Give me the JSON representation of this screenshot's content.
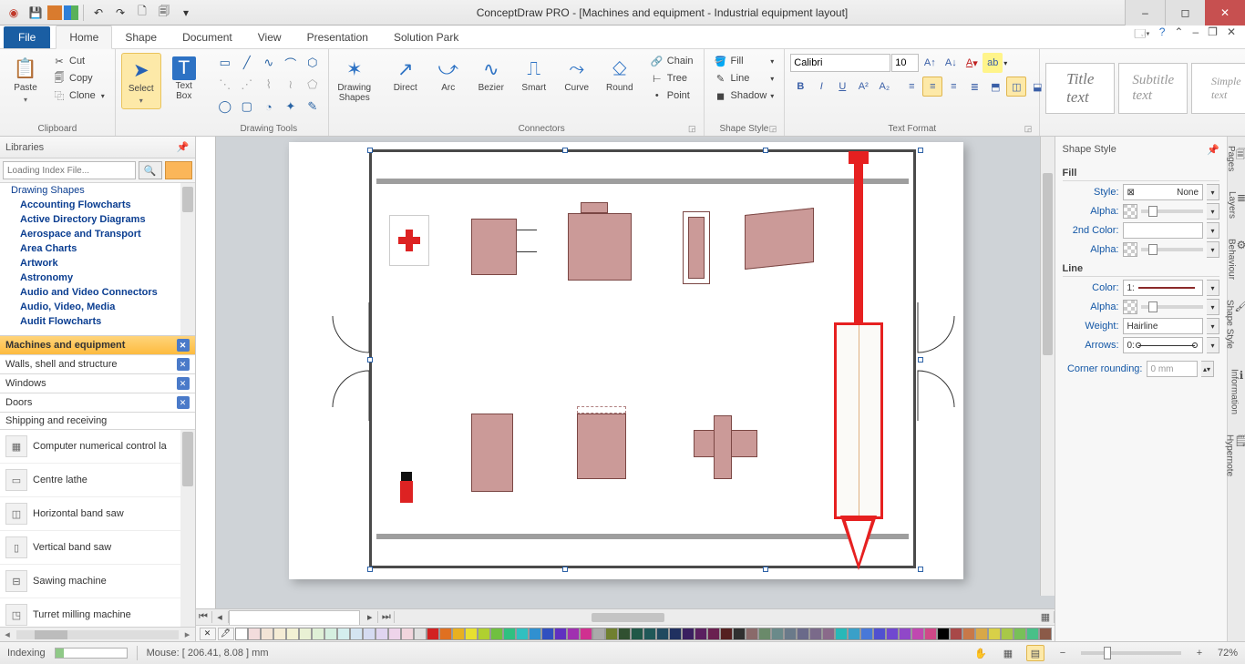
{
  "app_title": "ConceptDraw PRO - [Machines and equipment - Industrial equipment layout]",
  "tabs": {
    "file": "File",
    "home": "Home",
    "shape": "Shape",
    "document": "Document",
    "view": "View",
    "presentation": "Presentation",
    "solution": "Solution Park"
  },
  "ribbon": {
    "clipboard": {
      "label": "Clipboard",
      "paste": "Paste",
      "cut": "Cut",
      "copy": "Copy",
      "clone": "Clone"
    },
    "select": "Select",
    "textbox": "Text\nBox",
    "drawingtools": "Drawing Tools",
    "drawingshapes": "Drawing\nShapes",
    "connectors": {
      "label": "Connectors",
      "direct": "Direct",
      "arc": "Arc",
      "bezier": "Bezier",
      "smart": "Smart",
      "curve": "Curve",
      "round": "Round",
      "chain": "Chain",
      "tree": "Tree",
      "point": "Point"
    },
    "shapestyle": {
      "label": "Shape Style",
      "fill": "Fill",
      "line": "Line",
      "shadow": "Shadow"
    },
    "textformat": {
      "label": "Text Format",
      "font": "Calibri",
      "size": "10"
    },
    "stylegallery": {
      "title": "Title\ntext",
      "subtitle": "Subtitle\ntext",
      "simple": "Simple\ntext"
    }
  },
  "libraries": {
    "title": "Libraries",
    "search_placeholder": "Loading Index File...",
    "tree": [
      "Drawing Shapes",
      "Accounting Flowcharts",
      "Active Directory Diagrams",
      "Aerospace and Transport",
      "Area Charts",
      "Artwork",
      "Astronomy",
      "Audio and Video Connectors",
      "Audio, Video, Media",
      "Audit Flowcharts"
    ],
    "tabs": [
      {
        "label": "Machines and equipment",
        "active": true
      },
      {
        "label": "Walls, shell and structure"
      },
      {
        "label": "Windows"
      },
      {
        "label": "Doors"
      },
      {
        "label": "Shipping and receiving"
      }
    ],
    "shapes": [
      "Computer numerical control la",
      "Centre lathe",
      "Horizontal band saw",
      "Vertical band saw",
      "Sawing machine",
      "Turret milling machine"
    ]
  },
  "rightpanel": {
    "title": "Shape Style",
    "fill": "Fill",
    "line": "Line",
    "style": "Style:",
    "style_val": "None",
    "alpha": "Alpha:",
    "color2": "2nd Color:",
    "color": "Color:",
    "color_val": "1:",
    "weight": "Weight:",
    "weight_val": "Hairline",
    "arrows": "Arrows:",
    "arrows_val": "0:",
    "corner": "Corner rounding:",
    "corner_val": "0 mm",
    "tabs": [
      "Pages",
      "Layers",
      "Behaviour",
      "Shape Style",
      "Information",
      "Hypernote"
    ]
  },
  "status": {
    "indexing": "Indexing",
    "mouse": "Mouse: [ 206.41, 8.08 ] mm",
    "zoom": "72%"
  },
  "palette": [
    "#ffffff",
    "#f2dcdc",
    "#f2e4d6",
    "#f5ecd5",
    "#f3f1d4",
    "#e9f1d4",
    "#dff0d6",
    "#d5efe0",
    "#d4eeee",
    "#d4e5f2",
    "#d5dbf1",
    "#e0d5f0",
    "#eed4ea",
    "#f1d5dd",
    "#e0e0e0",
    "#d22222",
    "#e07020",
    "#e8b020",
    "#e8e030",
    "#b0d030",
    "#70c040",
    "#30c080",
    "#30c0c0",
    "#3090d0",
    "#3050c0",
    "#6030c0",
    "#a030b0",
    "#d03090",
    "#aaaaaa",
    "#708030",
    "#305030",
    "#205848",
    "#205858",
    "#204a60",
    "#203060",
    "#3a2060",
    "#5a2060",
    "#6a2050",
    "#552020",
    "#303030",
    "#8a6a6a",
    "#6a8a6a",
    "#6a8a8a",
    "#6a7a8a",
    "#6a6a8a",
    "#7a6a8a",
    "#8a6a8a",
    "#28b8b8",
    "#3aa0c8",
    "#4878d8",
    "#5050d0",
    "#7048d0",
    "#9048c8",
    "#c048b0",
    "#d04888",
    "#000000",
    "#a84848",
    "#c87848",
    "#d8a848",
    "#d8d048",
    "#a8c848",
    "#78c058",
    "#48c088",
    "#8b5a48"
  ]
}
